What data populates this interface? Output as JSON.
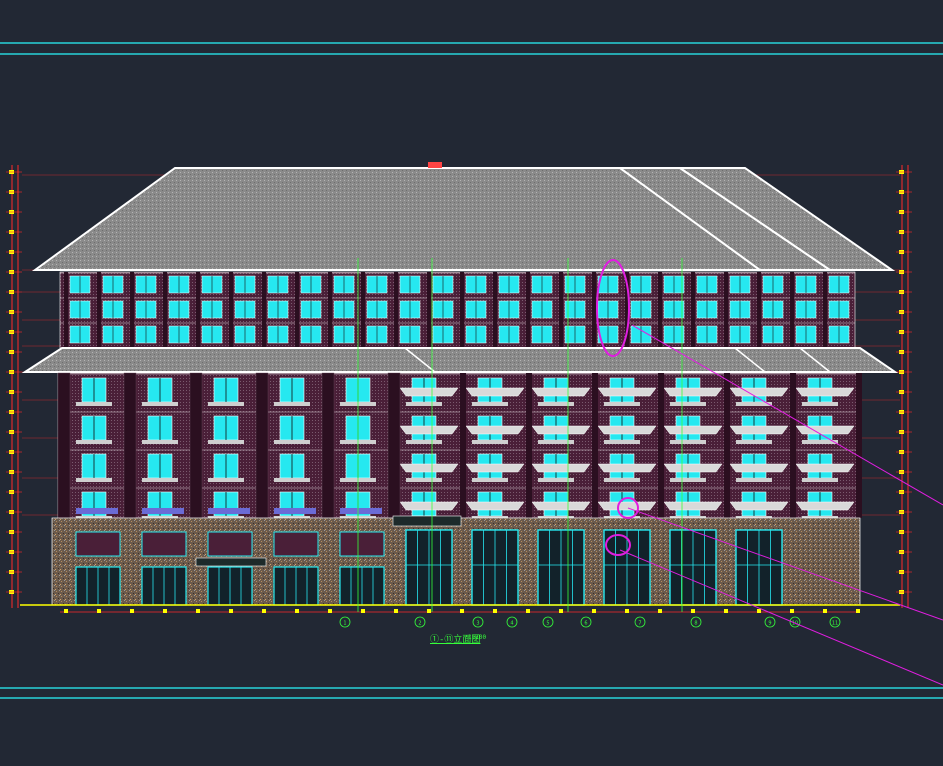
{
  "canvas": {
    "background": "#222834"
  },
  "colors": {
    "frame_line": "#27d3d9",
    "roof": "#8a8a8a",
    "roof_edge": "#ffffff",
    "wall": "#4a1f38",
    "window": "#26e8f0",
    "dimension": "#ff2a2a",
    "marker": "#ffff00",
    "leader": "#e01ee0",
    "guide": "#35ff3a",
    "stone": "#6b5a4c"
  },
  "drawing": {
    "caption": "①-⑪立面图",
    "scale": "1:100",
    "grid_axes": [
      "1",
      "2",
      "3",
      "4",
      "5",
      "6",
      "7",
      "8",
      "9",
      "10",
      "11"
    ]
  }
}
